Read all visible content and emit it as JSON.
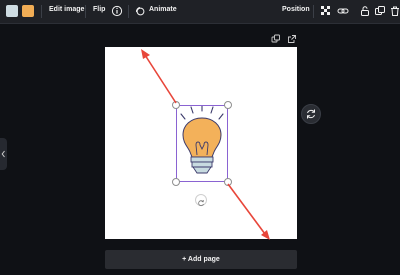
{
  "toolbar": {
    "edit_image_label": "Edit image",
    "flip_label": "Flip",
    "animate_label": "Animate",
    "position_label": "Position",
    "icons": [
      "color-swatch-blue",
      "color-swatch-orange",
      "info-icon",
      "animate-icon",
      "transparency-icon",
      "link-icon",
      "lock-icon",
      "duplicate-icon",
      "delete-icon"
    ],
    "swatch_colors": [
      "#cfdde3",
      "#f1ad55"
    ]
  },
  "canvas": {
    "page_tools": [
      "copy-page-icon",
      "share-page-icon"
    ],
    "selected_element": "lightbulb-graphic",
    "annotation_arrow_color": "#e8463a",
    "selection_color": "#8a63d2"
  },
  "add_page": {
    "label": "+ Add page"
  }
}
